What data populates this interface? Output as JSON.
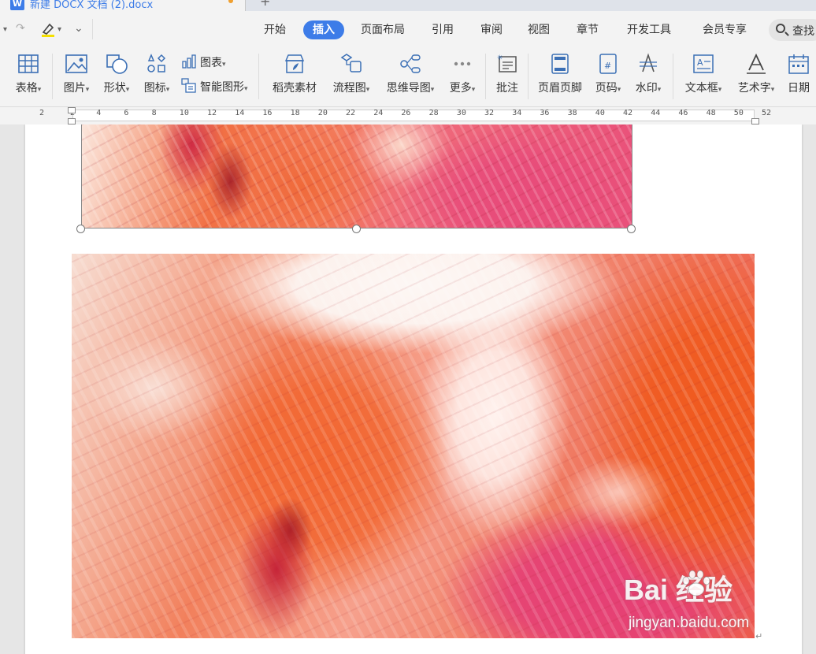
{
  "window": {
    "doc_tab_title": "新建 DOCX 文档 (2).docx",
    "app_icon_letter": "W",
    "new_tab_symbol": "+"
  },
  "quick_access": {
    "undo": "↶",
    "redo": "↷",
    "highlighter_caret": "▾",
    "more": "⌄"
  },
  "menu_tabs": [
    {
      "label": "开始",
      "active": false
    },
    {
      "label": "插入",
      "active": true
    },
    {
      "label": "页面布局",
      "active": false
    },
    {
      "label": "引用",
      "active": false
    },
    {
      "label": "审阅",
      "active": false
    },
    {
      "label": "视图",
      "active": false
    },
    {
      "label": "章节",
      "active": false
    },
    {
      "label": "开发工具",
      "active": false
    },
    {
      "label": "会员专享",
      "active": false
    }
  ],
  "search": {
    "label": "查找"
  },
  "ribbon": {
    "table": "表格",
    "picture": "图片",
    "shape": "形状",
    "icons": "图标",
    "chart": "图表",
    "smart_graphic": "智能图形",
    "daoke_material": "稻壳素材",
    "flowchart": "流程图",
    "mindmap": "思维导图",
    "more": "更多",
    "comment": "批注",
    "header_footer": "页眉页脚",
    "page_number": "页码",
    "watermark": "水印",
    "textbox": "文本框",
    "wordart": "艺术字",
    "date": "日期",
    "dropdown_caret": "▾"
  },
  "ruler": {
    "numbers": [
      "2",
      "2",
      "4",
      "6",
      "8",
      "10",
      "12",
      "14",
      "16",
      "18",
      "20",
      "22",
      "24",
      "26",
      "28",
      "30",
      "32",
      "34",
      "36",
      "38",
      "40",
      "42",
      "44",
      "46",
      "48",
      "50",
      "52"
    ]
  },
  "document": {
    "paragraph_mark": "↵"
  },
  "watermark_overlay": {
    "logo_text": "Bai  经验",
    "url": "jingyan.baidu.com"
  },
  "colors": {
    "accent": "#3d7ce8",
    "paint_orange": "#f0622a",
    "paint_pink": "#e8426e",
    "paint_crimson": "#c0203a",
    "paint_light": "#fbe6dc"
  }
}
